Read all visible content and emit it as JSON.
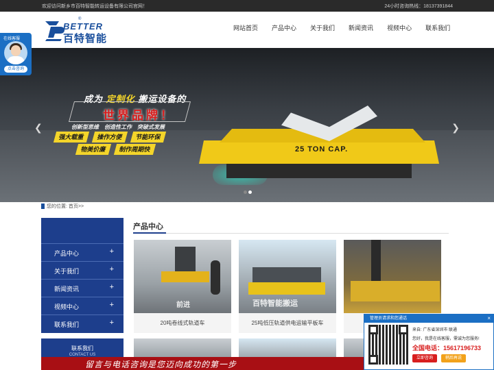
{
  "topbar": {
    "welcome": "欢迎访问新乡市百特智能转运设备有限公司官网！",
    "hotline": "24小时咨询热线：18137391844"
  },
  "logo": {
    "en": "BETTER",
    "cn": "百特智能",
    "reg": "®"
  },
  "nav": {
    "items": [
      {
        "label": "网站首页"
      },
      {
        "label": "产品中心"
      },
      {
        "label": "关于我们"
      },
      {
        "label": "新闻资讯"
      },
      {
        "label": "视频中心"
      },
      {
        "label": "联系我们"
      }
    ]
  },
  "online_service": {
    "label": "在线客服",
    "button": "点击咨询"
  },
  "banner": {
    "slogan_prefix": "成为",
    "slogan_highlight": "定制化",
    "slogan_suffix": "搬运设备的",
    "slogan_big": "世界品牌！",
    "slogan_sub": "创新型思维　创造性工作　突破式发展",
    "tags": [
      "强大载重",
      "操作方便",
      "节能环保",
      "物美价廉",
      "制作周期快"
    ],
    "cart_text": "25 TON CAP.",
    "prev_icon": "chevron-left-icon",
    "next_icon": "chevron-right-icon",
    "slides": 2,
    "active_slide": 2
  },
  "breadcrumb": {
    "text": "您的位置: 首页>>"
  },
  "sidebar": {
    "items": [
      {
        "label": "产品中心"
      },
      {
        "label": "关于我们"
      },
      {
        "label": "新闻资讯"
      },
      {
        "label": "视频中心"
      },
      {
        "label": "联系我们"
      }
    ],
    "plus": "+"
  },
  "contact": {
    "title": "联系我们",
    "subtitle": "CONTACT US"
  },
  "products": {
    "title": "产品中心",
    "items": [
      {
        "caption": "20吨卷线式轨道车",
        "watermark": "前进"
      },
      {
        "caption": "25吨低压轨道供电运输平板车",
        "watermark": "百特智能搬运"
      },
      {
        "caption": "",
        "watermark": ""
      }
    ]
  },
  "bottom_banner": {
    "text": "留言与电话咨询是您迈向成功的第一步"
  },
  "chat": {
    "header": "管理员请求和您通话",
    "close": "×",
    "from": "来自: 广东省深圳市 联通",
    "message": "您好，我是在线客服，需诚为您服务!",
    "phone": "全国电话：15617196733",
    "btn_chat": "立即咨询",
    "btn_later": "稍后再说"
  },
  "colors": {
    "brand_blue": "#1d3e8c",
    "accent_yellow": "#f4d52a",
    "accent_red": "#a80f14"
  }
}
